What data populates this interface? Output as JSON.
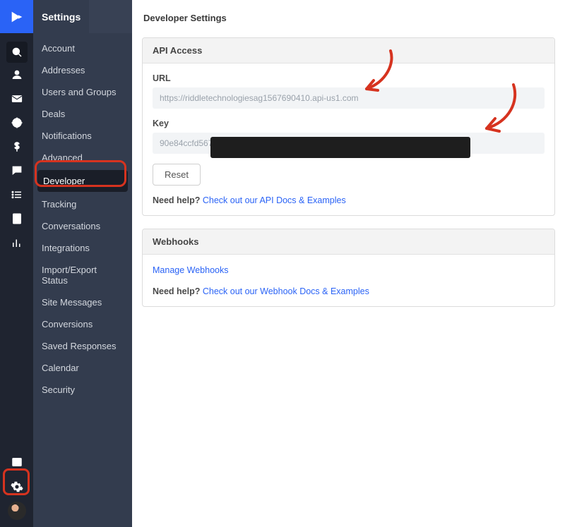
{
  "sidebar": {
    "title": "Settings",
    "items": [
      {
        "label": "Account"
      },
      {
        "label": "Addresses"
      },
      {
        "label": "Users and Groups"
      },
      {
        "label": "Deals"
      },
      {
        "label": "Notifications"
      },
      {
        "label": "Advanced"
      },
      {
        "label": "Developer",
        "active": true
      },
      {
        "label": "Tracking"
      },
      {
        "label": "Conversations"
      },
      {
        "label": "Integrations"
      },
      {
        "label": "Import/Export Status"
      },
      {
        "label": "Site Messages"
      },
      {
        "label": "Conversions"
      },
      {
        "label": "Saved Responses"
      },
      {
        "label": "Calendar"
      },
      {
        "label": "Security"
      }
    ]
  },
  "page": {
    "title": "Developer Settings"
  },
  "api": {
    "panel_title": "API Access",
    "url_label": "URL",
    "url_value": "https://riddletechnologiesag1567690410.api-us1.com",
    "key_label": "Key",
    "key_visible_prefix": "90e84ccfd567",
    "reset_label": "Reset",
    "help_prefix": "Need help? ",
    "help_link": "Check out our API Docs & Examples"
  },
  "webhooks": {
    "panel_title": "Webhooks",
    "manage_link": "Manage Webhooks",
    "help_prefix": "Need help? ",
    "help_link": "Check out our Webhook Docs & Examples"
  }
}
